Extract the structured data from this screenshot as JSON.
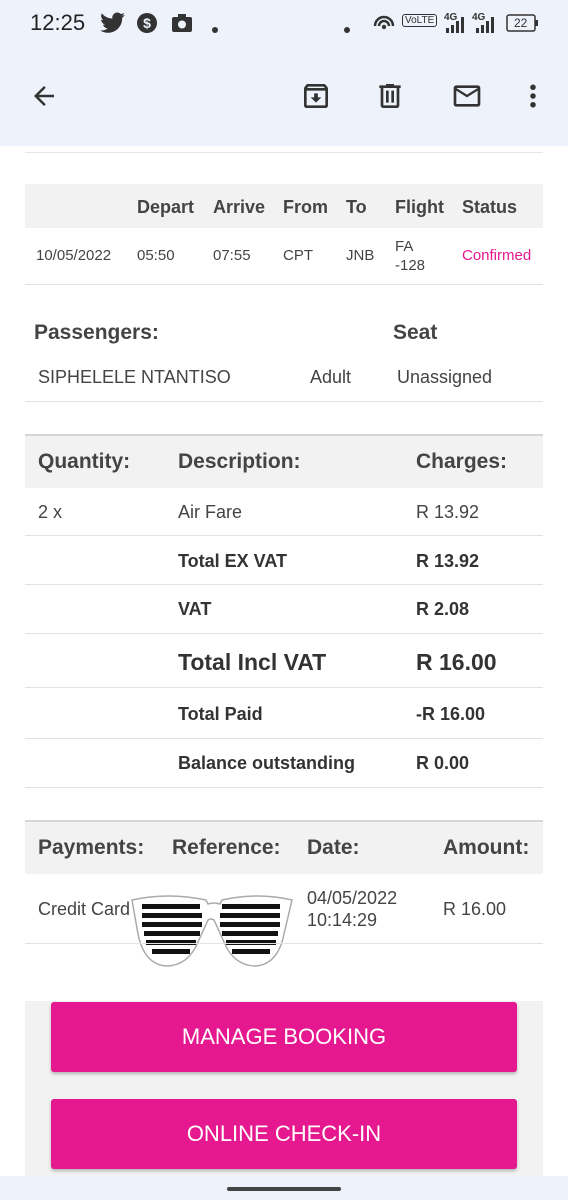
{
  "status_bar": {
    "time": "12:25",
    "left_icons": [
      "twitter-icon",
      "dollar-icon",
      "camera-icon",
      "dot-icon"
    ],
    "network": "VoLTE",
    "net1": "4G",
    "net2": "4G",
    "battery": "22"
  },
  "app_bar": {
    "icons": [
      "back-arrow-icon",
      "archive-icon",
      "delete-icon",
      "mail-icon",
      "more-vert-icon"
    ]
  },
  "flight_table": {
    "headers": [
      "Depart",
      "Arrive",
      "From",
      "To",
      "Flight",
      "Status"
    ],
    "row": {
      "date": "10/05/2022",
      "depart": "05:50",
      "arrive": "07:55",
      "from": "CPT",
      "to": "JNB",
      "flight_line1": "FA",
      "flight_line2": "-128",
      "status": "Confirmed"
    },
    "accent_color": "#e5178e"
  },
  "passengers": {
    "header": "Passengers:",
    "seat_header": "Seat",
    "name": "SIPHELELE NTANTISO",
    "type": "Adult",
    "seat": "Unassigned"
  },
  "charges": {
    "headers": [
      "Quantity:",
      "Description:",
      "Charges:"
    ],
    "rows": [
      {
        "qty": "2 x",
        "desc": "Air Fare",
        "amount": "R 13.92"
      },
      {
        "qty": "",
        "desc": "Total EX VAT",
        "amount": "R 13.92"
      },
      {
        "qty": "",
        "desc": "VAT",
        "amount": "R 2.08"
      },
      {
        "qty": "",
        "desc": "Total Incl VAT",
        "amount": "R 16.00"
      },
      {
        "qty": "",
        "desc": "Total Paid",
        "amount": "-R 16.00"
      },
      {
        "qty": "",
        "desc": "Balance outstanding",
        "amount": "R 0.00"
      }
    ]
  },
  "payments": {
    "headers": [
      "Payments:",
      "Reference:",
      "Date:",
      "Amount:"
    ],
    "row": {
      "method": "Credit Card",
      "date_line1": "04/05/2022",
      "date_line2": "10:14:29",
      "amount": "R 16.00"
    }
  },
  "buttons": {
    "manage": "MANAGE BOOKING",
    "checkin": "ONLINE CHECK-IN",
    "color": "#e5188f"
  }
}
